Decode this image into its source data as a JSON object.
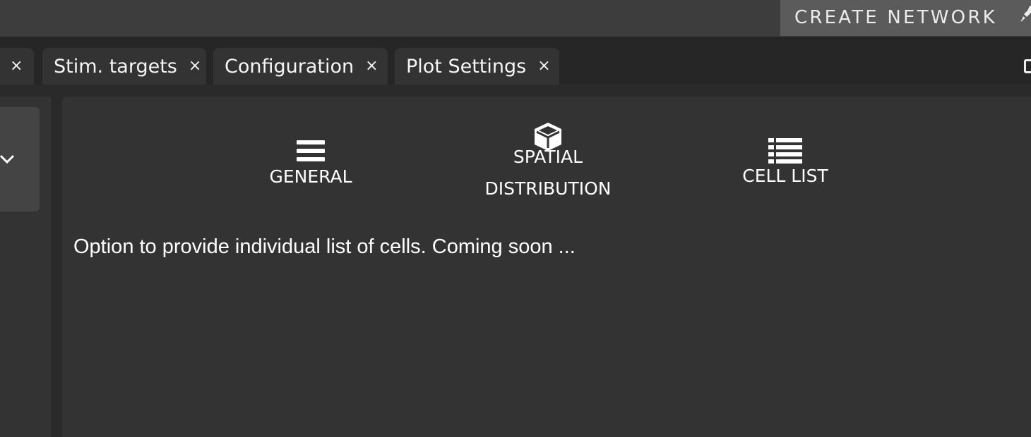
{
  "header": {
    "create_button_label": "CREATE NETWORK",
    "create_button_icon": "rocket-icon"
  },
  "tabs": [
    {
      "label": "",
      "close": "×"
    },
    {
      "label": "Stim. targets",
      "close": "×"
    },
    {
      "label": "Configuration",
      "close": "×"
    },
    {
      "label": "Plot Settings",
      "close": "×"
    }
  ],
  "nav": {
    "general": {
      "label": "GENERAL",
      "icon": "hamburger-menu-icon"
    },
    "spatial": {
      "label_line1": "SPATIAL",
      "label_line2": "DISTRIBUTION",
      "icon": "cube-icon"
    },
    "cell_list": {
      "label": "CELL LIST",
      "icon": "list-icon"
    }
  },
  "content": {
    "message": "Option to provide individual list of cells. Coming soon ..."
  },
  "colors": {
    "topbar": "#3d3d3d",
    "create_button": "#5b5b5b",
    "tab": "#333333",
    "panel": "#333333",
    "background": "#262626"
  }
}
